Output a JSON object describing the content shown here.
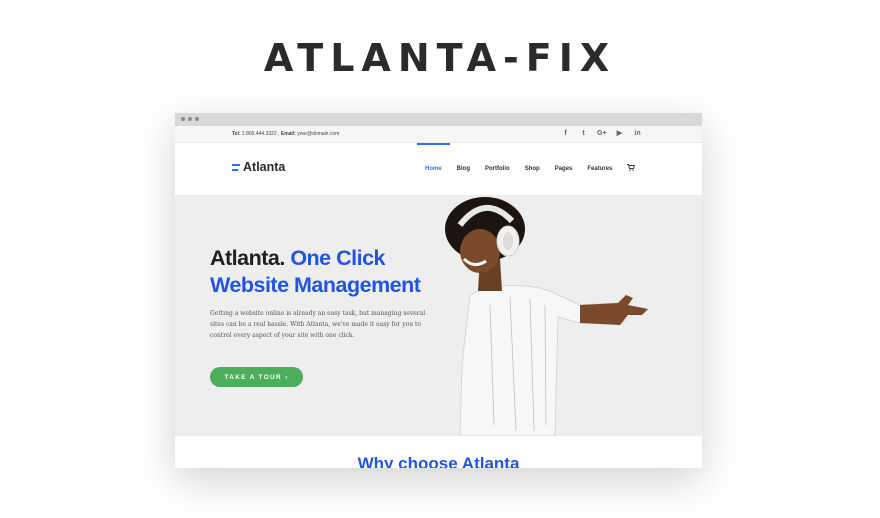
{
  "banner": {
    "title": "ATLANTA-FIX"
  },
  "topbar": {
    "tel_label": "Tel:",
    "tel_value": "1.800.444.3322 ,",
    "email_label": "Email:",
    "email_value": "your@domain.com",
    "socials": [
      "facebook-icon",
      "twitter-icon",
      "google-plus-icon",
      "youtube-icon",
      "linkedin-icon"
    ],
    "social_glyphs": {
      "facebook": "f",
      "twitter": "t",
      "google": "G+",
      "youtube": "▶",
      "linkedin": "in"
    }
  },
  "header": {
    "logo_text": "Atlanta",
    "nav": [
      "Home",
      "Blog",
      "Portfolio",
      "Shop",
      "Pages",
      "Features"
    ],
    "active_nav": "Home",
    "cart_icon": "cart-icon"
  },
  "hero": {
    "title_dark": "Atlanta.",
    "title_blue_1": "One Click",
    "title_blue_2": "Website Management",
    "description": "Getting a website online is already an easy task, but managing several sites can be a real hassle. With Atlanta, we've made it easy for you to control every aspect of your site with one click.",
    "cta_label": "TAKE A TOUR ›"
  },
  "section": {
    "heading": "Why choose Atlanta"
  },
  "colors": {
    "accent": "#2154e6",
    "cta": "#4cae5a",
    "hero_bg": "#eeeeee"
  }
}
